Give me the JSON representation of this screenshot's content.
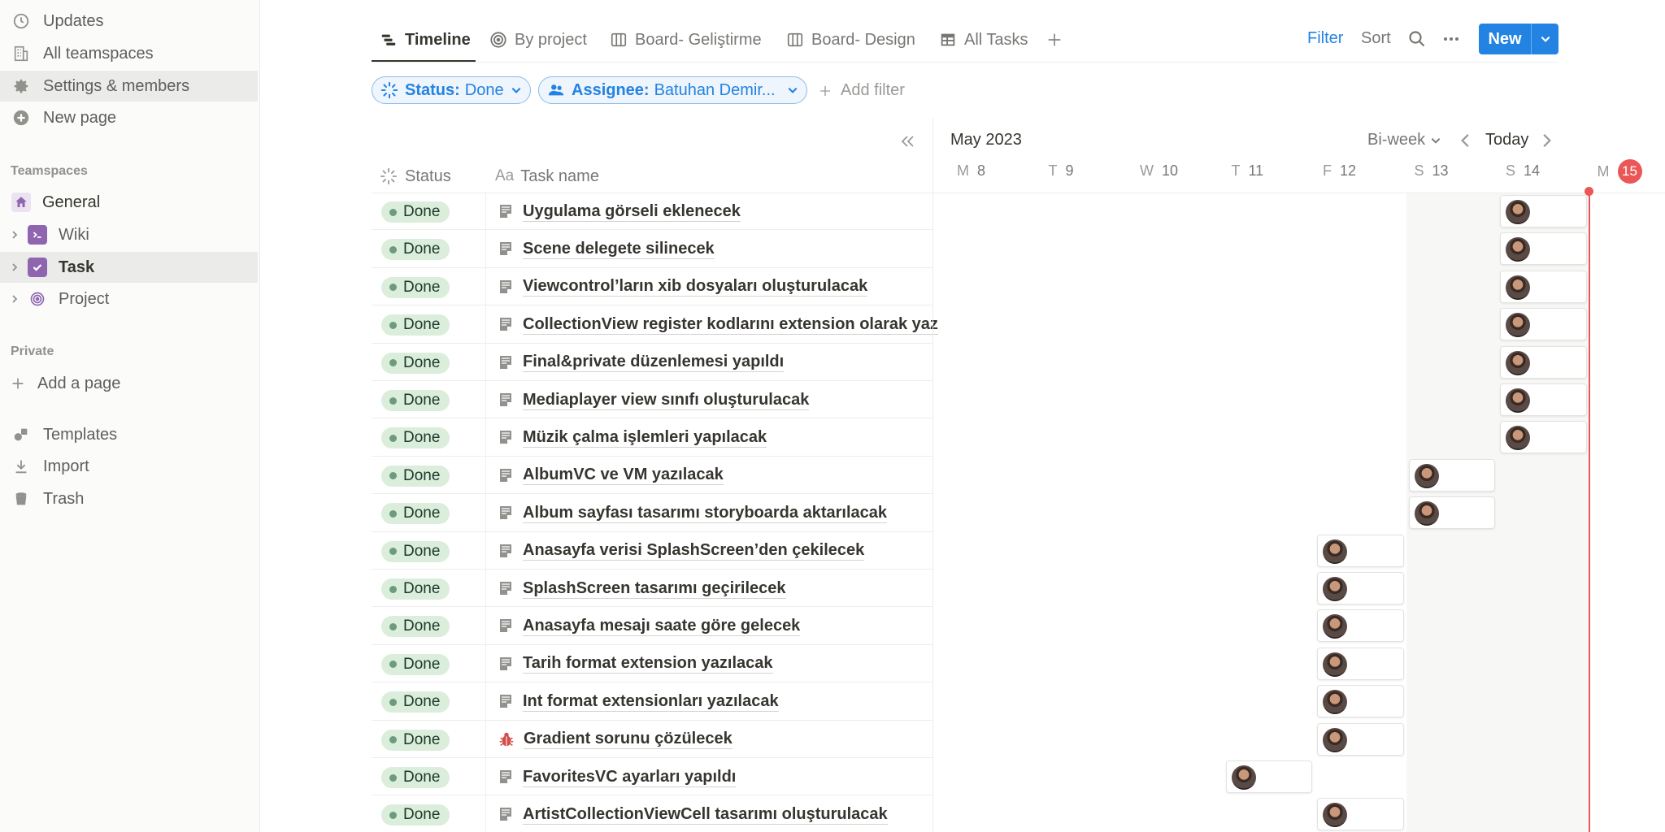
{
  "sidebar": {
    "top_items": [
      {
        "label": "Updates",
        "icon": "clock-icon"
      },
      {
        "label": "All teamspaces",
        "icon": "building-icon"
      },
      {
        "label": "Settings & members",
        "icon": "gear-icon"
      },
      {
        "label": "New page",
        "icon": "plus-circle-icon"
      }
    ],
    "teamspaces_label": "Teamspaces",
    "teamspaces": [
      {
        "label": "General",
        "icon": "home-icon",
        "color": "#9065b0"
      },
      {
        "label": "Wiki",
        "icon": "terminal-icon",
        "color": "#9065b0"
      },
      {
        "label": "Task",
        "icon": "checkbox-icon",
        "color": "#9065b0"
      },
      {
        "label": "Project",
        "icon": "target-icon",
        "color": "#9065b0"
      }
    ],
    "private_label": "Private",
    "add_page": "Add a page",
    "bottom_items": [
      {
        "label": "Templates",
        "icon": "shapes-icon"
      },
      {
        "label": "Import",
        "icon": "download-icon"
      },
      {
        "label": "Trash",
        "icon": "trash-icon"
      }
    ]
  },
  "tabs": [
    {
      "label": "Timeline",
      "icon": "timeline-icon"
    },
    {
      "label": "By project",
      "icon": "target-icon"
    },
    {
      "label": "Board- Geliştirme",
      "icon": "board-icon"
    },
    {
      "label": "Board- Design",
      "icon": "board-icon"
    },
    {
      "label": "All Tasks",
      "icon": "table-icon"
    }
  ],
  "toolbar": {
    "filter": "Filter",
    "sort": "Sort",
    "new": "New"
  },
  "filters": {
    "status_key": "Status:",
    "status_value": "Done",
    "assignee_key": "Assignee:",
    "assignee_value": "Batuhan Demir...",
    "add_filter": "Add filter"
  },
  "table": {
    "headers": {
      "status": "Status",
      "task_icon": "Aa",
      "task": "Task name"
    },
    "rows": [
      {
        "status": "Done",
        "name": "Uygulama görseli eklenecek",
        "icon": "page-icon",
        "day": 14
      },
      {
        "status": "Done",
        "name": "Scene delegete silinecek",
        "icon": "page-icon",
        "day": 14
      },
      {
        "status": "Done",
        "name": "Viewcontrol’ların xib dosyaları oluşturulacak",
        "icon": "page-icon",
        "day": 14
      },
      {
        "status": "Done",
        "name": "CollectionView register kodlarını extension olarak yaz",
        "icon": "page-icon",
        "day": 14
      },
      {
        "status": "Done",
        "name": "Final&private düzenlemesi yapıldı",
        "icon": "page-icon",
        "day": 14
      },
      {
        "status": "Done",
        "name": "Mediaplayer view sınıfı oluşturulacak",
        "icon": "page-icon",
        "day": 14
      },
      {
        "status": "Done",
        "name": "Müzik çalma işlemleri yapılacak",
        "icon": "page-icon",
        "day": 14
      },
      {
        "status": "Done",
        "name": "AlbumVC ve VM yazılacak",
        "icon": "page-icon",
        "day": 13
      },
      {
        "status": "Done",
        "name": "Album sayfası tasarımı storyboarda aktarılacak",
        "icon": "page-icon",
        "day": 13
      },
      {
        "status": "Done",
        "name": "Anasayfa verisi SplashScreen’den çekilecek",
        "icon": "page-icon",
        "day": 12
      },
      {
        "status": "Done",
        "name": "SplashScreen tasarımı geçirilecek",
        "icon": "page-icon",
        "day": 12
      },
      {
        "status": "Done",
        "name": "Anasayfa mesajı saate göre gelecek",
        "icon": "page-icon",
        "day": 12
      },
      {
        "status": "Done",
        "name": "Tarih format extension yazılacak",
        "icon": "page-icon",
        "day": 12
      },
      {
        "status": "Done",
        "name": "Int format extensionları yazılacak",
        "icon": "page-icon",
        "day": 12
      },
      {
        "status": "Done",
        "name": "Gradient sorunu çözülecek",
        "icon": "bug-icon",
        "day": 12
      },
      {
        "status": "Done",
        "name": "FavoritesVC ayarları yapıldı",
        "icon": "page-icon",
        "day": 11
      },
      {
        "status": "Done",
        "name": "ArtistCollectionViewCell tasarımı oluşturulacak",
        "icon": "page-icon",
        "day": 12
      }
    ]
  },
  "timeline": {
    "month": "May 2023",
    "range": "Bi-week",
    "today": "Today",
    "days": [
      {
        "letter": "M",
        "num": "8"
      },
      {
        "letter": "T",
        "num": "9"
      },
      {
        "letter": "W",
        "num": "10"
      },
      {
        "letter": "T",
        "num": "11"
      },
      {
        "letter": "F",
        "num": "12"
      },
      {
        "letter": "S",
        "num": "13"
      },
      {
        "letter": "S",
        "num": "14"
      },
      {
        "letter": "M",
        "num": "15"
      }
    ],
    "today_day": 15,
    "accent": "#eb5757"
  },
  "colors": {
    "accent": "#2383e2",
    "done_bg": "#dbeddb",
    "done_dot": "#6c9b7d",
    "workspace": "#9065b0"
  }
}
